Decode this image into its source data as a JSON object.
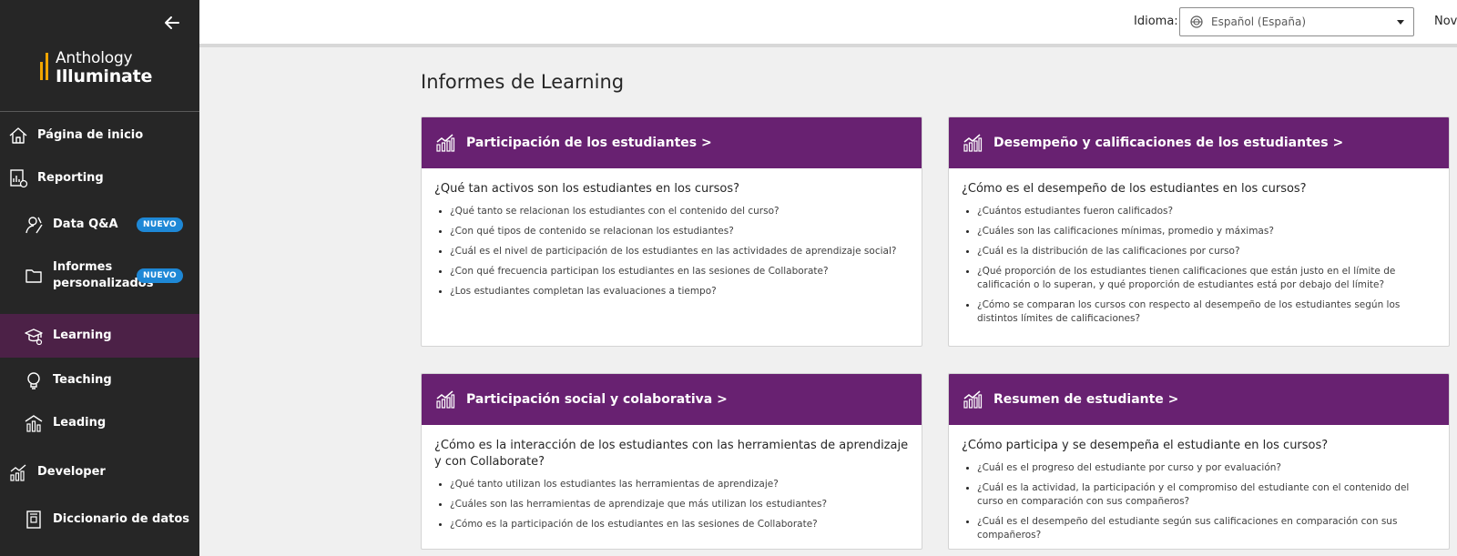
{
  "sidebar": {
    "logo": {
      "line1": "Anthology",
      "line2": "Illuminate"
    },
    "items": [
      {
        "label": "Página de inicio",
        "icon": "home-icon"
      },
      {
        "label": "Reporting",
        "icon": "report-icon"
      },
      {
        "label": "Data Q&A",
        "icon": "data-qa-icon",
        "badge": "NUEVO"
      },
      {
        "label": "Informes personalizados",
        "icon": "folder-icon",
        "badge": "NUEVO"
      },
      {
        "label": "Learning",
        "icon": "learning-cap-icon",
        "active": true
      },
      {
        "label": "Teaching",
        "icon": "lightbulb-icon"
      },
      {
        "label": "Leading",
        "icon": "building-chart-icon"
      },
      {
        "label": "Developer",
        "icon": "developer-chart-icon"
      },
      {
        "label": "Diccionario de datos",
        "icon": "book-icon"
      }
    ]
  },
  "topbar": {
    "language_label": "Idioma:",
    "language_value": "Español (España)",
    "truncated_text": "Nove"
  },
  "main": {
    "title": "Informes de Learning",
    "cards": [
      {
        "title": "Participación de los estudiantes >",
        "question": "¿Qué tan activos son los estudiantes en los cursos?",
        "items": [
          "¿Qué tanto se relacionan los estudiantes con el contenido del curso?",
          "¿Con qué tipos de contenido se relacionan los estudiantes?",
          "¿Cuál es el nivel de participación de los estudiantes en las actividades de aprendizaje social?",
          "¿Con qué frecuencia participan los estudiantes en las sesiones de Collaborate?",
          "¿Los estudiantes completan las evaluaciones a tiempo?"
        ]
      },
      {
        "title": "Desempeño y calificaciones de los estudiantes >",
        "question": "¿Cómo es el desempeño de los estudiantes en los cursos?",
        "items": [
          "¿Cuántos estudiantes fueron calificados?",
          "¿Cuáles son las calificaciones mínimas, promedio y máximas?",
          "¿Cuál es la distribución de las calificaciones por curso?",
          "¿Qué proporción de los estudiantes tienen calificaciones que están justo en el límite de calificación o lo superan, y qué proporción de estudiantes está por debajo del límite?",
          "¿Cómo se comparan los cursos con respecto al desempeño de los estudiantes según los distintos límites de calificaciones?"
        ]
      },
      {
        "title": "Participación social y colaborativa >",
        "question": "¿Cómo es la interacción de los estudiantes con las herramientas de aprendizaje y con Collaborate?",
        "items": [
          "¿Qué tanto utilizan los estudiantes las herramientas de aprendizaje?",
          "¿Cuáles son las herramientas de aprendizaje que más utilizan los estudiantes?",
          "¿Cómo es la participación de los estudiantes en las sesiones de Collaborate?"
        ]
      },
      {
        "title": "Resumen de estudiante >",
        "question": "¿Cómo participa y se desempeña el estudiante en los cursos?",
        "items": [
          "¿Cuál es el progreso del estudiante por curso y por evaluación?",
          "¿Cuál es la actividad, la participación y el compromiso del estudiante con el contenido del curso en comparación con sus compañeros?",
          "¿Cuál es el desempeño del estudiante según sus calificaciones en comparación con sus compañeros?"
        ]
      }
    ]
  },
  "colors": {
    "sidebar_bg": "#262626",
    "active_bg": "#4c2147",
    "card_header": "#682171",
    "badge": "#1e88d6",
    "logo_accent": "#f0a400"
  }
}
